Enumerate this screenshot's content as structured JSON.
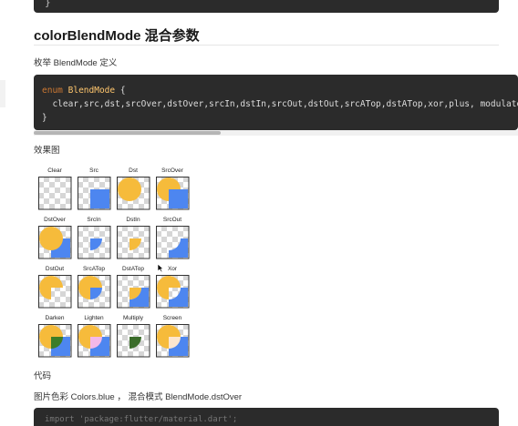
{
  "top_code": {
    "text": "}"
  },
  "section": {
    "title": "colorBlendMode 混合参数"
  },
  "enum_caption": "枚举 BlendMode 定义",
  "code_block": {
    "keyword": "enum",
    "type_name": "BlendMode",
    "brace_open": "{",
    "values_line": "clear,src,dst,srcOver,dstOver,srcIn,dstIn,srcOut,dstOut,srcATop,dstATop,xor,plus, modulate,",
    "brace_close": "}"
  },
  "effect_caption": "效果图",
  "blend_grid": {
    "labels": [
      "Clear",
      "Src",
      "Dst",
      "SrcOver",
      "DstOver",
      "SrcIn",
      "DstIn",
      "SrcOut",
      "DstOut",
      "SrcATop",
      "DstATop",
      "Xor",
      "Darken",
      "Lighten",
      "Multiply",
      "Screen"
    ]
  },
  "code_caption": "代码",
  "color_line": "图片色彩 Colors.blue ， 混合模式 BlendMode.dstOver",
  "bottom_code": {
    "text": "import 'package:flutter/material.dart';"
  },
  "colors": {
    "circle": "#f6bb3b",
    "square": "#4d86f0",
    "code_bg": "#2b2b2b"
  }
}
